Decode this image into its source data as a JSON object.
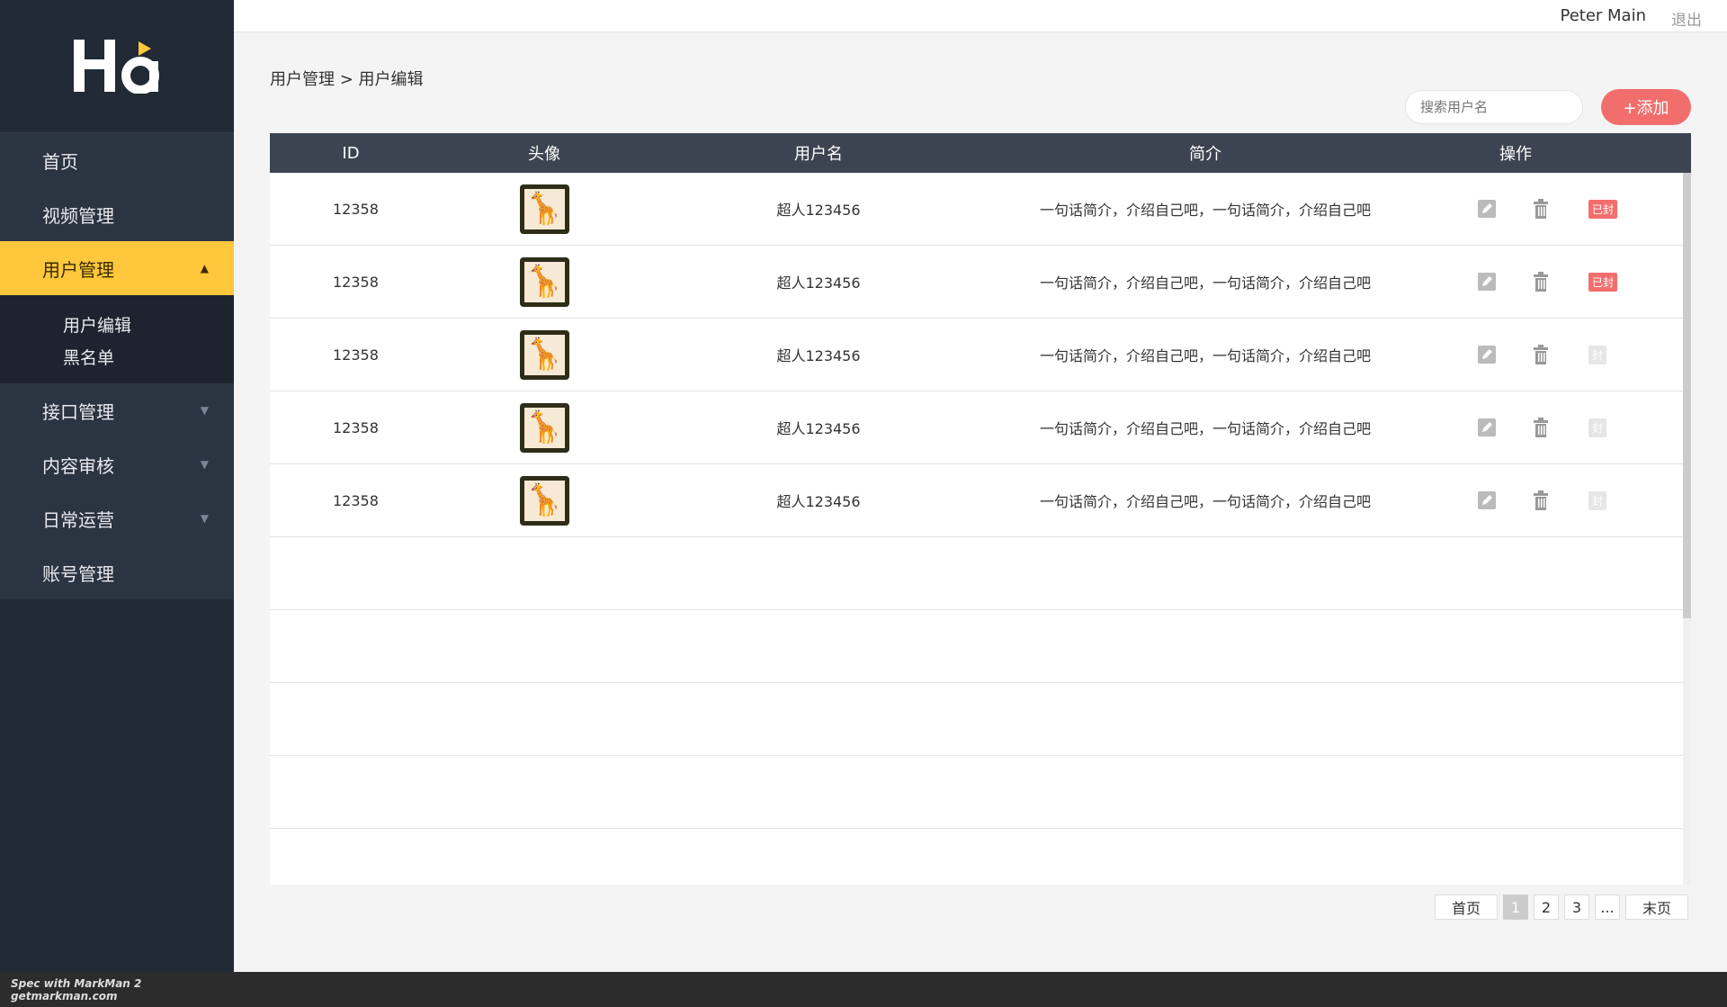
{
  "app": {
    "logo_icon": "ha-logo"
  },
  "header": {
    "user_name": "Peter Main",
    "logout": "退出"
  },
  "sidebar": {
    "items": [
      {
        "label": "首页"
      },
      {
        "label": "视频管理"
      },
      {
        "label": "用户管理",
        "active": true,
        "caret": "▲"
      },
      {
        "label": "接口管理",
        "caret": "▼"
      },
      {
        "label": "内容审核",
        "caret": "▼"
      },
      {
        "label": "日常运营",
        "caret": "▼"
      },
      {
        "label": "账号管理"
      }
    ],
    "subitems": [
      {
        "label": "用户编辑"
      },
      {
        "label": "黑名单"
      }
    ]
  },
  "breadcrumb": {
    "text": "用户管理 > 用户编辑"
  },
  "toolbar": {
    "search_placeholder": "搜索用户名",
    "add_label": "+添加"
  },
  "table": {
    "columns": [
      "ID",
      "头像",
      "用户名",
      "简介",
      "操作"
    ],
    "rows": [
      {
        "id": "12358",
        "username": "超人123456",
        "desc": "一句话简介，介绍自己吧，一句话简介，介绍自己吧",
        "ban": "已封",
        "banned": true
      },
      {
        "id": "12358",
        "username": "超人123456",
        "desc": "一句话简介，介绍自己吧，一句话简介，介绍自己吧",
        "ban": "已封",
        "banned": true
      },
      {
        "id": "12358",
        "username": "超人123456",
        "desc": "一句话简介，介绍自己吧，一句话简介，介绍自己吧",
        "ban": "封",
        "banned": false
      },
      {
        "id": "12358",
        "username": "超人123456",
        "desc": "一句话简介，介绍自己吧，一句话简介，介绍自己吧",
        "ban": "封",
        "banned": false
      },
      {
        "id": "12358",
        "username": "超人123456",
        "desc": "一句话简介，介绍自己吧，一句话简介，介绍自己吧",
        "ban": "封",
        "banned": false
      }
    ],
    "empty_rows": 5
  },
  "pagination": {
    "first": "首页",
    "pages": [
      "1",
      "2",
      "3"
    ],
    "current": "1",
    "ellipsis": "...",
    "last": "末页"
  },
  "footer": {
    "brand": "Spec with MarkMan 2",
    "site": "getmarkman.com"
  },
  "colors": {
    "sidebar_bg": "#222a36",
    "active": "#fec73c",
    "accent": "#f26e6c",
    "table_head": "#3b4450"
  }
}
